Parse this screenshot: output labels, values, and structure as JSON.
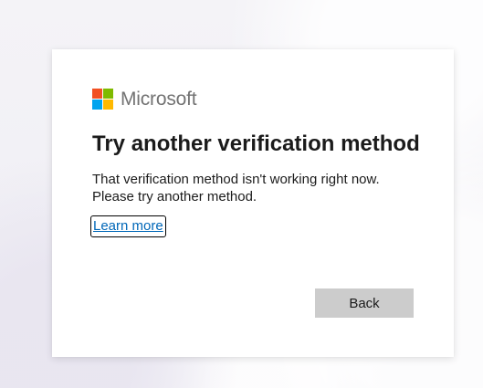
{
  "brand": {
    "name": "Microsoft",
    "logo_colors": [
      "#f25022",
      "#7fba00",
      "#00a4ef",
      "#ffb900"
    ]
  },
  "dialog": {
    "title": "Try another verification method",
    "body_lines": [
      "That verification method isn't working right now.",
      "Please try another method."
    ],
    "learn_more_label": "Learn more",
    "back_button_label": "Back"
  },
  "colors": {
    "link": "#0067b8",
    "button_bg": "#cccccc",
    "text": "#1b1b1b"
  }
}
